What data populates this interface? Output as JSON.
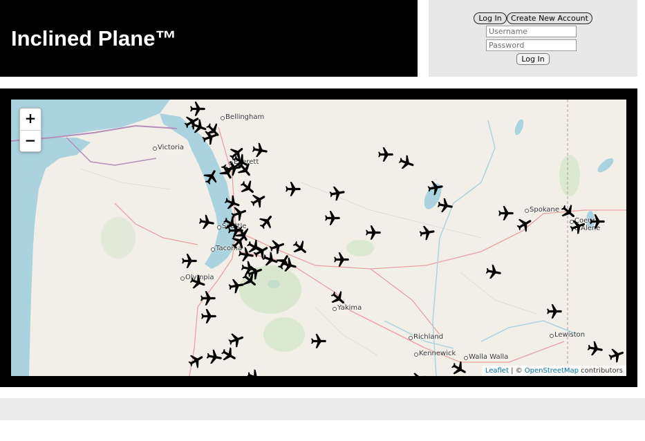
{
  "header": {
    "title": "Inclined Plane™"
  },
  "login": {
    "login_tab_label": "Log In",
    "create_account_label": "Create New Account",
    "username_placeholder": "Username",
    "password_placeholder": "Password",
    "submit_label": "Log In"
  },
  "map": {
    "zoom_in_label": "+",
    "zoom_out_label": "−",
    "attribution": {
      "leaflet": "Leaflet",
      "separator": " | © ",
      "osm": "OpenStreetMap",
      "suffix": " contributors"
    },
    "cities": [
      "Bellingham",
      "Victoria",
      "Everett",
      "Seattle",
      "Tacoma",
      "Olympia",
      "Spokane",
      "Coeur d'Alene",
      "Yakima",
      "Richland",
      "Kennewick",
      "Walla Walla",
      "Lewiston"
    ],
    "aircraft_icon": "airplane-icon",
    "colors": {
      "water": "#aad3df",
      "land": "#f2efe9",
      "forest": "#cde4c1",
      "road": "#e8a0a0",
      "border": "#b48eb8",
      "plane": "#000000"
    }
  }
}
